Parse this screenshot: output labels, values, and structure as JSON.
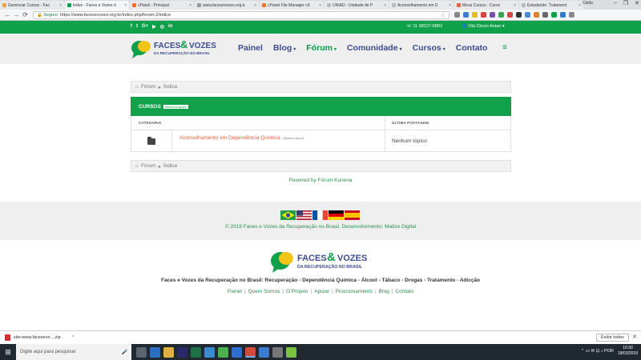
{
  "browser": {
    "tabs": [
      {
        "title": "Gerenciar Cursos - Fac",
        "color": "#e8a33d",
        "active": false
      },
      {
        "title": "Index - Faces e Vozes d",
        "color": "#12a14b",
        "active": true
      },
      {
        "title": "cPanel - Principal",
        "color": "#ff6c2c",
        "active": false
      },
      {
        "title": "www.facesevozes.org.b",
        "color": "#999999",
        "active": false
      },
      {
        "title": "cPanel File Manager v3",
        "color": "#ff6c2c",
        "active": false
      },
      {
        "title": "UNIAD - Unidade de P",
        "color": "#bbbbbb",
        "active": false
      },
      {
        "title": "Aconselhamento em D",
        "color": "#bbbbbb",
        "active": false
      },
      {
        "title": "Meus Cursos - Curso",
        "color": "#e8643a",
        "active": false
      },
      {
        "title": "Estudando: Tratament",
        "color": "#bbbbbb",
        "active": false
      }
    ],
    "tab_close": "×",
    "user": "Cleão",
    "window_controls": [
      "–",
      "❐",
      "✕"
    ],
    "nav": {
      "back": "←",
      "forward": "→",
      "reload": "⟳"
    },
    "secure_label": "🔒 Seguro",
    "url": "https://www.facesevozes.org.br/index.php/forum-2/indice",
    "star": "☆",
    "extension_colors": [
      "#888888",
      "#3a7bd5",
      "#e0c020",
      "#d94040",
      "#7b52ab",
      "#3aa655",
      "#d44a4a",
      "#333333",
      "#4a8bd5",
      "#e08030",
      "#666666",
      "#0fa04a",
      "#2f7bd6",
      "#8a8a8a"
    ]
  },
  "topbar": {
    "social": [
      "f",
      "t",
      "G+",
      "▶",
      "◎",
      "in"
    ],
    "phone": "☏ 11 98127-6802",
    "greeting": "👤 Olá Clecio Antao ▾"
  },
  "header": {
    "logo_line1": "FACES",
    "logo_amp": "&",
    "logo_line2": "VOZES",
    "logo_sub": "DA RECUPERAÇÃO NO BRASIL",
    "nav": [
      {
        "label": "Painel",
        "caret": false,
        "current": false
      },
      {
        "label": "Blog",
        "caret": true,
        "current": false
      },
      {
        "label": "Fórum",
        "caret": true,
        "current": true
      },
      {
        "label": "Comunidade",
        "caret": true,
        "current": false
      },
      {
        "label": "Cursos",
        "caret": true,
        "current": false
      },
      {
        "label": "Contato",
        "caret": false,
        "current": false
      }
    ],
    "caret_glyph": "▾",
    "menu_icon": "≡"
  },
  "breadcrumb": {
    "home_icon": "⌂",
    "forum": "Fórum",
    "sep": "▸",
    "current": "Índice"
  },
  "category": {
    "title": "Cursos",
    "badge": "Nenhum tópico",
    "col_category": "CATEGORIA",
    "col_last": "ÚLTIMA POSTAGEM",
    "row_name": "Aconselhamento em Dependência Química",
    "row_sub": "(Nenhum tópico)",
    "row_last": "Nenhum tópico"
  },
  "powered": "Powered by Fórum Kunena",
  "footer": {
    "copyright": "© 2018 Faces e Vozes da Recuperação no Brasil. Desenvolvimento:",
    "developer": "Matize Digital",
    "tagline": "Faces e Vozes da Recuperação no Brasil:  Recuperação - Dependência Química - Álcool - Tábaco - Drogas - Tratamento - Adicção",
    "links": [
      "Painel",
      "Quem Somos",
      "O Projeto",
      "Apoiar",
      "Posicionamento",
      "Blog",
      "Contato"
    ],
    "link_sep": "|"
  },
  "download": {
    "file": "site-www.facesevo....zip",
    "caret": "^",
    "show_all": "Exibir todos",
    "close": "✕"
  },
  "taskbar": {
    "start": "⊞",
    "search": "Digite aqui para pesquisar",
    "mic": "🎤",
    "apps": [
      {
        "name": "task-view",
        "color": "#5a6370"
      },
      {
        "name": "edge",
        "color": "#2b6fc4"
      },
      {
        "name": "explorer",
        "color": "#e0b040"
      },
      {
        "name": "premiere",
        "color": "#2a2a6a"
      },
      {
        "name": "excel",
        "color": "#1e7145"
      },
      {
        "name": "app-box",
        "color": "#3a8ad0"
      },
      {
        "name": "app-green",
        "color": "#4caf50"
      },
      {
        "name": "app-blue",
        "color": "#2f6fd0"
      },
      {
        "name": "chrome",
        "color": "#d44a3a"
      },
      {
        "name": "paint",
        "color": "#3a7bd5"
      },
      {
        "name": "photos",
        "color": "#777777"
      },
      {
        "name": "utorrent",
        "color": "#7cc242"
      }
    ],
    "time": "10:30",
    "date": "18/03/2018",
    "tray_icons": "⌃ ▭ ✉ ⊡ ♪ POR"
  }
}
